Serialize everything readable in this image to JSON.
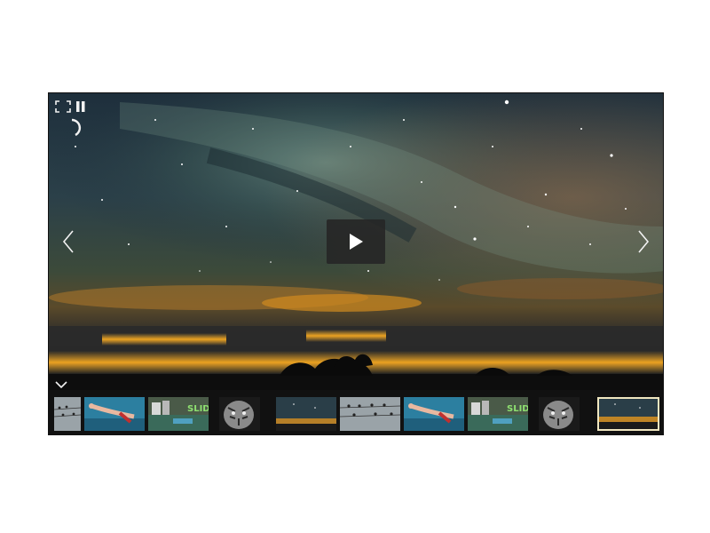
{
  "slider": {
    "main_slide": {
      "image": "milky-way-night-sky-over-clouds-sunset",
      "play_icon": "play-icon"
    },
    "controls": {
      "fullscreen_icon": "fullscreen-icon",
      "pause_icon": "pause-icon",
      "loading_icon": "loading-spinner-icon",
      "prev_icon": "chevron-left-icon",
      "next_icon": "chevron-right-icon",
      "thumbs_toggle_icon": "chevron-down-icon"
    },
    "thumbnails": [
      {
        "image": "birds-on-wire",
        "active": false
      },
      {
        "image": "swimmer-underwater",
        "active": false
      },
      {
        "image": "slide-caption",
        "caption": "SLIDE",
        "active": false
      },
      {
        "image": "tiger-bw",
        "active": false
      },
      {
        "image": "night-sky",
        "active": false
      },
      {
        "image": "birds-on-wire",
        "active": false
      },
      {
        "image": "swimmer-underwater",
        "active": false
      },
      {
        "image": "slide-caption",
        "caption": "SLIDE",
        "active": false
      },
      {
        "image": "tiger-bw",
        "active": false
      },
      {
        "image": "night-sky",
        "active": true
      }
    ],
    "colors": {
      "frame": "#000000",
      "thumb_bar": "#111111",
      "active_border": "#f0e7c0",
      "sky_top": "#1c2c3c",
      "horizon_glow": "#f2a020"
    }
  }
}
